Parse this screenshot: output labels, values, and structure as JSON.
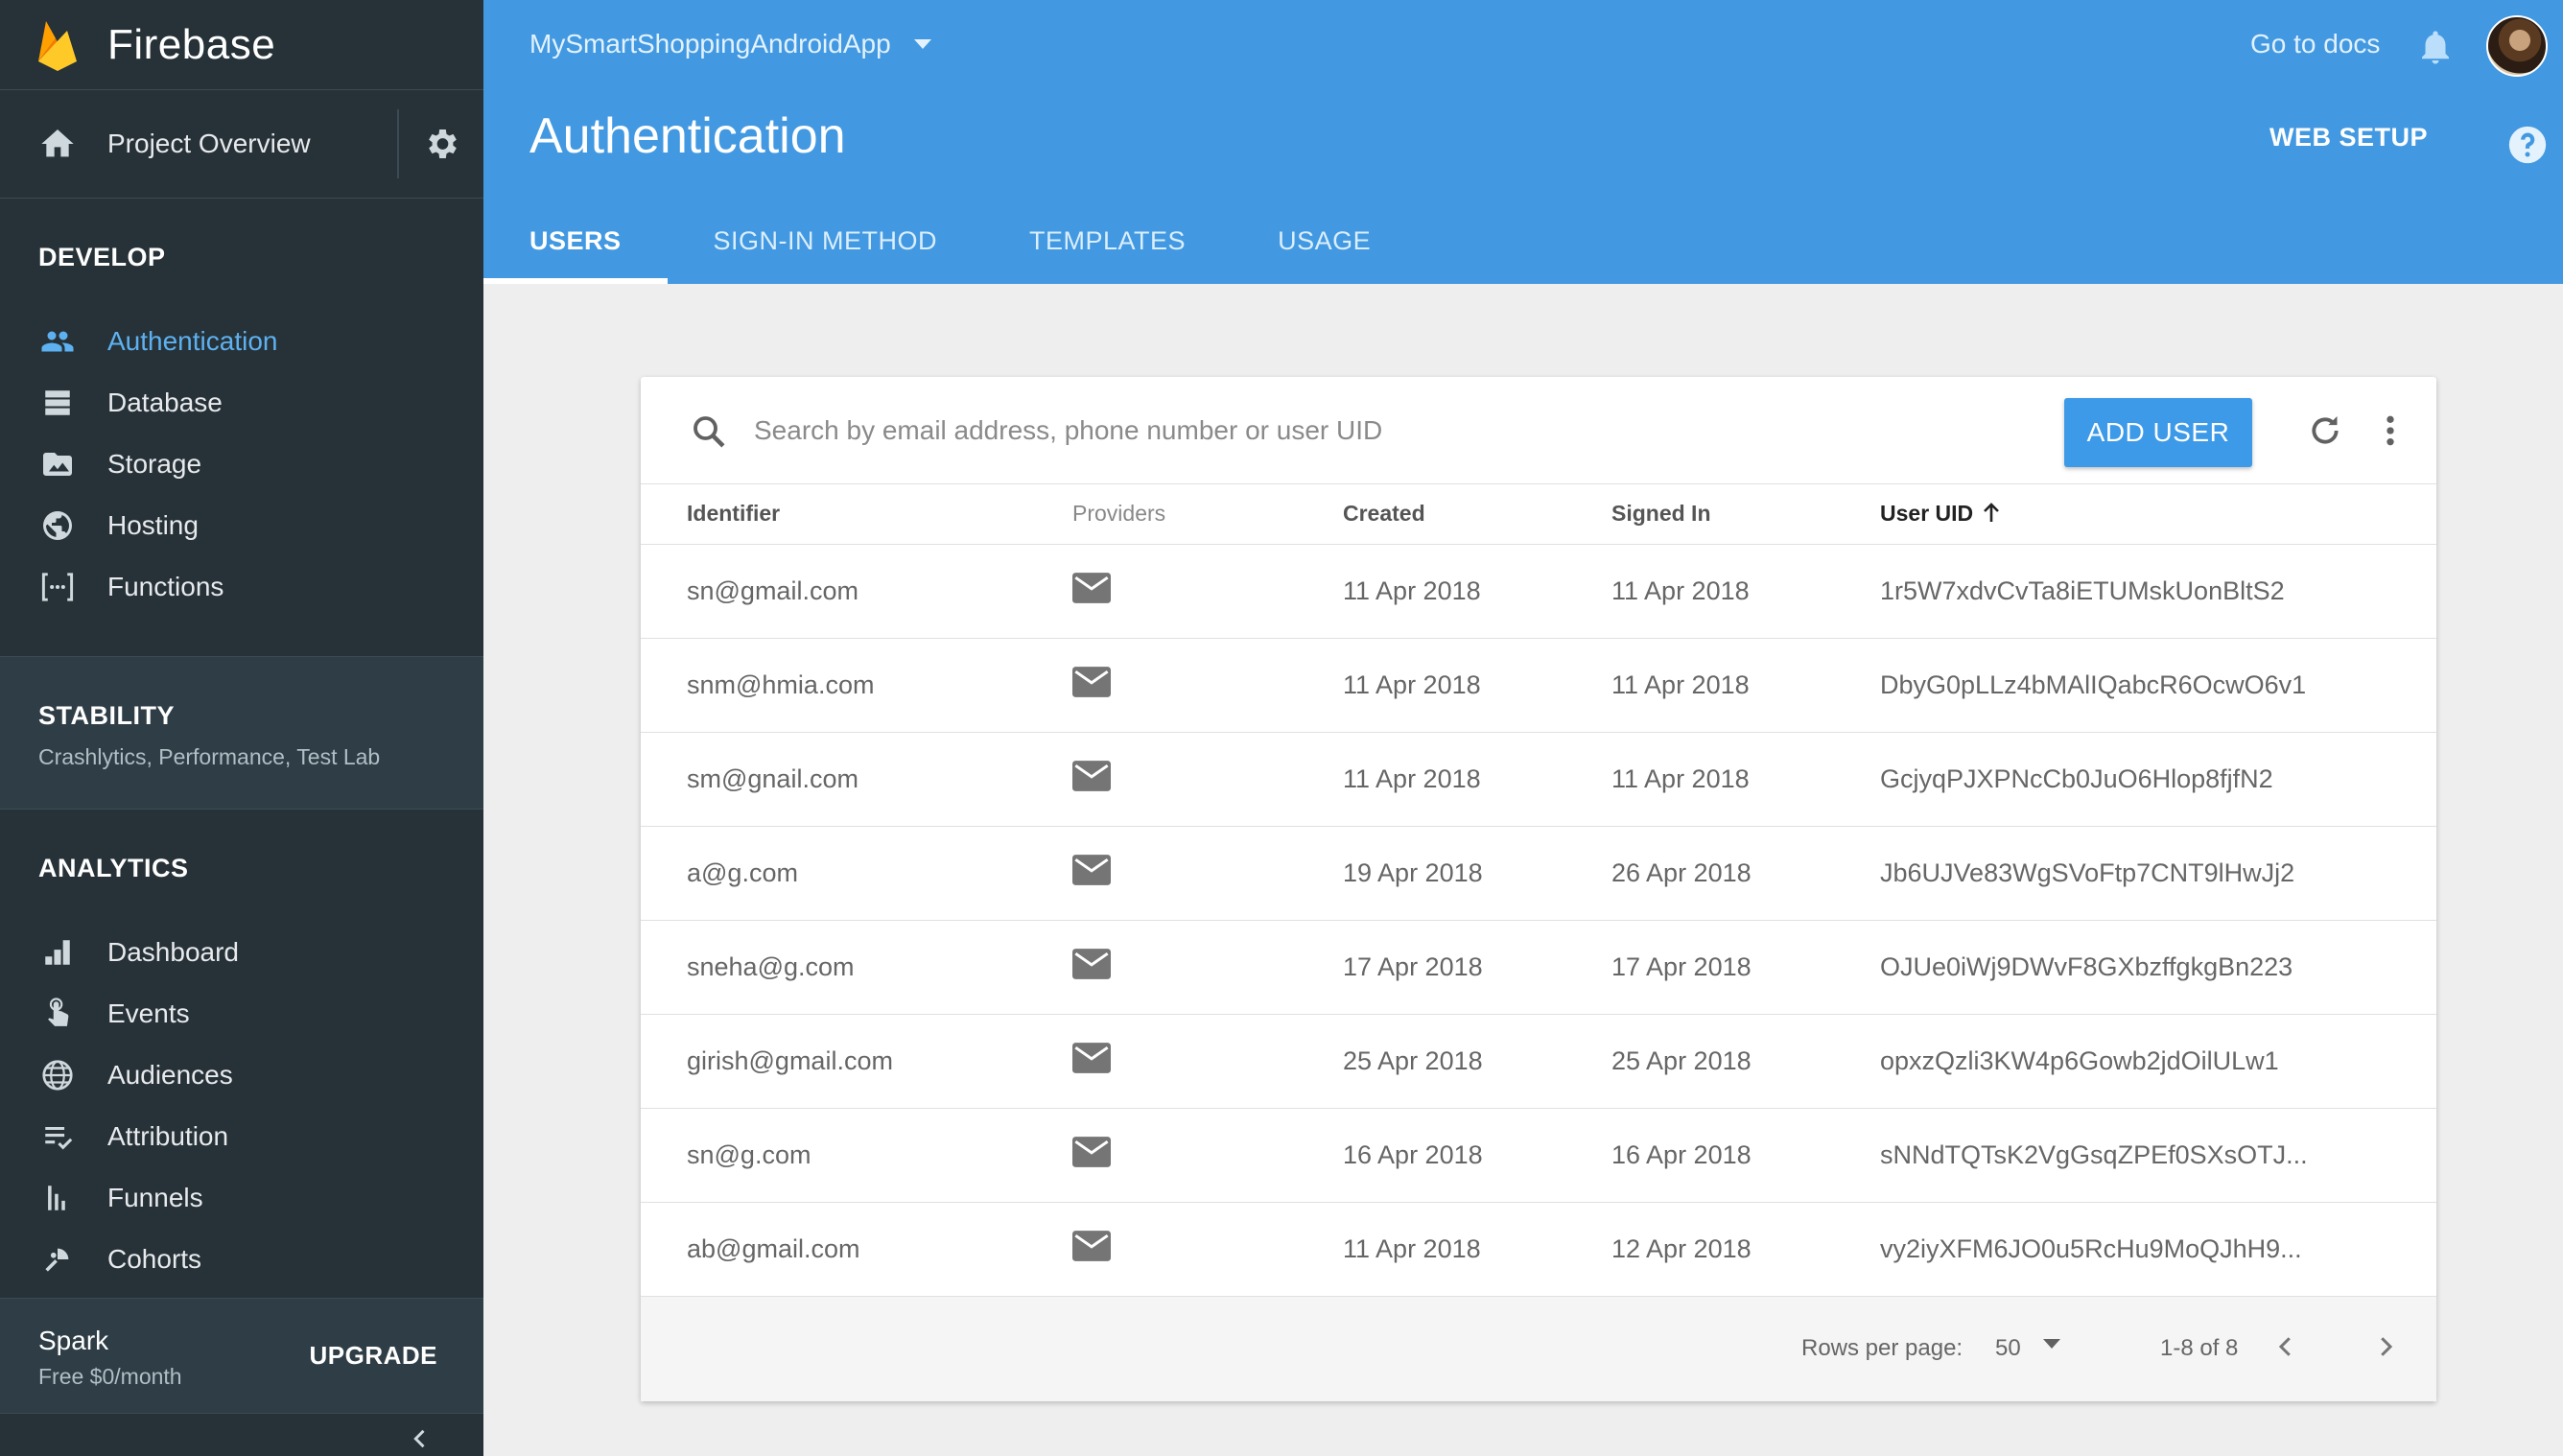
{
  "brand": {
    "name": "Firebase"
  },
  "sidebar": {
    "overview_label": "Project Overview",
    "develop": {
      "title": "DEVELOP",
      "items": [
        {
          "label": "Authentication",
          "icon": "people-icon",
          "active": true
        },
        {
          "label": "Database",
          "icon": "database-icon"
        },
        {
          "label": "Storage",
          "icon": "image-folder-icon"
        },
        {
          "label": "Hosting",
          "icon": "globe-icon"
        },
        {
          "label": "Functions",
          "icon": "functions-icon"
        }
      ]
    },
    "stability": {
      "title": "STABILITY",
      "subtitle": "Crashlytics, Performance, Test Lab"
    },
    "analytics": {
      "title": "ANALYTICS",
      "items": [
        {
          "label": "Dashboard",
          "icon": "bar-chart-icon"
        },
        {
          "label": "Events",
          "icon": "touch-icon"
        },
        {
          "label": "Audiences",
          "icon": "globe-grid-icon"
        },
        {
          "label": "Attribution",
          "icon": "list-check-icon"
        },
        {
          "label": "Funnels",
          "icon": "funnel-bars-icon"
        },
        {
          "label": "Cohorts",
          "icon": "cohorts-icon"
        }
      ]
    },
    "plan": {
      "name": "Spark",
      "price": "Free $0/month",
      "upgrade": "UPGRADE"
    }
  },
  "header": {
    "project": "MySmartShoppingAndroidApp",
    "docs": "Go to docs",
    "title": "Authentication",
    "web_setup": "WEB SETUP",
    "tabs": [
      {
        "label": "USERS",
        "active": true
      },
      {
        "label": "SIGN-IN METHOD"
      },
      {
        "label": "TEMPLATES"
      },
      {
        "label": "USAGE"
      }
    ]
  },
  "users": {
    "search_placeholder": "Search by email address, phone number or user UID",
    "add_user": "ADD USER",
    "columns": [
      "Identifier",
      "Providers",
      "Created",
      "Signed In",
      "User UID"
    ],
    "rows": [
      {
        "identifier": "sn@gmail.com",
        "provider": "email",
        "created": "11 Apr 2018",
        "signed_in": "11 Apr 2018",
        "uid": "1r5W7xdvCvTa8iETUMskUonBltS2"
      },
      {
        "identifier": "snm@hmia.com",
        "provider": "email",
        "created": "11 Apr 2018",
        "signed_in": "11 Apr 2018",
        "uid": "DbyG0pLLz4bMAlIQabcR6OcwO6v1"
      },
      {
        "identifier": "sm@gnail.com",
        "provider": "email",
        "created": "11 Apr 2018",
        "signed_in": "11 Apr 2018",
        "uid": "GcjyqPJXPNcCb0JuO6Hlop8fjfN2"
      },
      {
        "identifier": "a@g.com",
        "provider": "email",
        "created": "19 Apr 2018",
        "signed_in": "26 Apr 2018",
        "uid": "Jb6UJVe83WgSVoFtp7CNT9lHwJj2"
      },
      {
        "identifier": "sneha@g.com",
        "provider": "email",
        "created": "17 Apr 2018",
        "signed_in": "17 Apr 2018",
        "uid": "OJUe0iWj9DWvF8GXbzffgkgBn223"
      },
      {
        "identifier": "girish@gmail.com",
        "provider": "email",
        "created": "25 Apr 2018",
        "signed_in": "25 Apr 2018",
        "uid": "opxzQzli3KW4p6Gowb2jdOilULw1"
      },
      {
        "identifier": "sn@g.com",
        "provider": "email",
        "created": "16 Apr 2018",
        "signed_in": "16 Apr 2018",
        "uid": "sNNdTQTsK2VgGsqZPEf0SXsOTJ..."
      },
      {
        "identifier": "ab@gmail.com",
        "provider": "email",
        "created": "11 Apr 2018",
        "signed_in": "12 Apr 2018",
        "uid": "vy2iyXFM6JO0u5RcHu9MoQJhH9..."
      }
    ],
    "pagination": {
      "rows_per_page_label": "Rows per page:",
      "rows_per_page": "50",
      "range": "1-8 of 8"
    }
  },
  "colors": {
    "sidebar": "#263238",
    "header": "#4299e1",
    "accent": "#3d9ae8",
    "active_nav": "#5eb1f0"
  }
}
